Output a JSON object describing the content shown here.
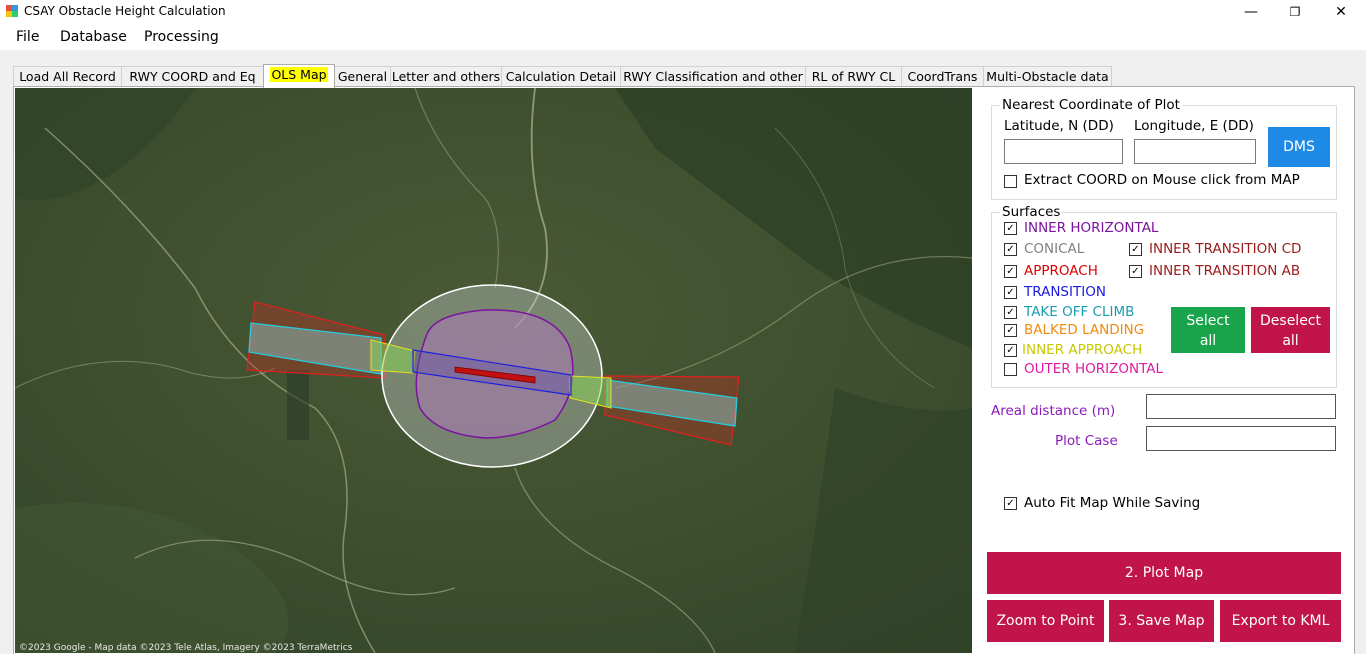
{
  "window": {
    "title": "CSAY Obstacle Height Calculation",
    "minimize": "—",
    "maximize": "❐",
    "close": "✕"
  },
  "menu": [
    "File",
    "Database",
    "Processing"
  ],
  "tabs": [
    "Load All Record",
    "RWY COORD and Eq",
    "OLS Map",
    "General",
    "Letter and others",
    "Calculation Detail",
    "RWY Classification and other",
    "RL of RWY CL",
    "CoordTrans",
    "Multi-Obstacle data"
  ],
  "active_tab": "OLS Map",
  "map": {
    "attribution": "©2023 Google - Map data ©2023 Tele Atlas, Imagery ©2023 TerraMetrics"
  },
  "nearest": {
    "title": "Nearest Coordinate of Plot",
    "lat_label": "Latitude, N (DD)",
    "lon_label": "Longitude, E (DD)",
    "lat_value": "",
    "lon_value": "",
    "dms_button": "DMS",
    "extract_label": "Extract COORD on Mouse click from MAP",
    "extract_checked": false
  },
  "surfaces": {
    "title": "Surfaces",
    "items": [
      {
        "label": "INNER HORIZONTAL",
        "color": "#7b12a0",
        "checked": true
      },
      {
        "label": "CONICAL",
        "color": "#808080",
        "checked": true
      },
      {
        "label": "INNER TRANSITION CD",
        "color": "#9c1a1a",
        "checked": true
      },
      {
        "label": "APPROACH",
        "color": "#e00000",
        "checked": true
      },
      {
        "label": "INNER TRANSITION AB",
        "color": "#9c1a1a",
        "checked": true
      },
      {
        "label": "TRANSITION",
        "color": "#1a1ae0",
        "checked": true
      },
      {
        "label": "TAKE OFF CLIMB",
        "color": "#1a9cb0",
        "checked": true
      },
      {
        "label": "BALKED LANDING",
        "color": "#f08a10",
        "checked": true
      },
      {
        "label": "INNER APPROACH",
        "color": "#c8c800",
        "checked": true
      },
      {
        "label": "OUTER HORIZONTAL",
        "color": "#e01aa0",
        "checked": false
      }
    ],
    "select_all": "Select all",
    "deselect_all": "Deselect all"
  },
  "areal_label": "Areal distance (m)",
  "areal_value": "",
  "plot_case_label": "Plot Case",
  "plot_case_value": "",
  "label_color": "#8a1ab8",
  "autofit_label": "Auto Fit Map While Saving",
  "autofit_checked": true,
  "buttons": {
    "plot_map": "2. Plot Map",
    "zoom": "Zoom to Point",
    "save": "3. Save Map",
    "export": "Export to KML"
  },
  "colors": {
    "accent_red": "#c0144a",
    "accent_green": "#19a34a",
    "accent_blue": "#1e8ae6"
  }
}
